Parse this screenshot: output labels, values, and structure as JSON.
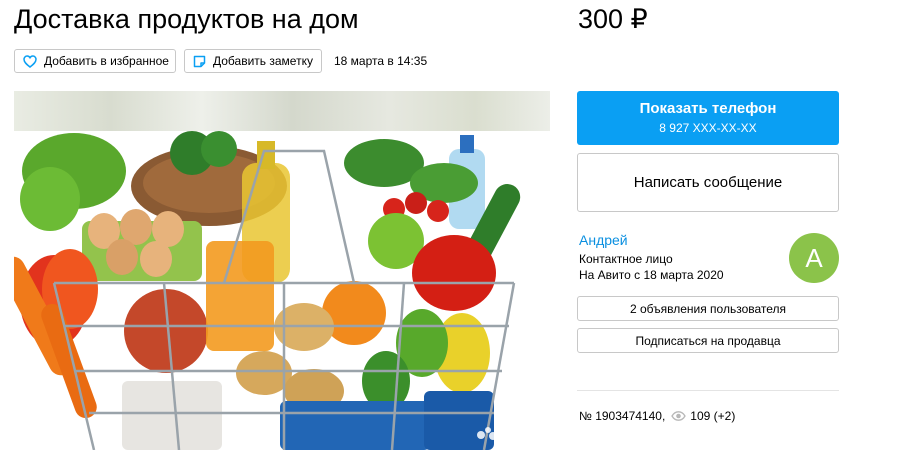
{
  "listing": {
    "title": "Доставка продуктов на дом",
    "price": "300 ₽",
    "date": "18 марта в 14:35"
  },
  "actions": {
    "favorite_label": "Добавить в избранное",
    "note_label": "Добавить заметку"
  },
  "photo": {
    "watermark": "Avito"
  },
  "contact": {
    "phone_title": "Показать телефон",
    "phone_number": "8 927 XXX-XX-XX",
    "message_label": "Написать сообщение"
  },
  "seller": {
    "name": "Андрей",
    "type": "Контактное лицо",
    "since": "На Авито с 18 марта 2020",
    "avatar_letter": "А",
    "ads_label": "2 объявления пользователя",
    "subscribe_label": "Подписаться на продавца"
  },
  "stats": {
    "id_text": "№ 1903474140,",
    "views_text": "109 (+2)"
  },
  "colors": {
    "accent": "#0a9ff3",
    "link": "#0a8fe0",
    "avatar": "#8bc34a",
    "border": "#c8c8c8"
  },
  "icons": {
    "favorite": "heart-outline-icon",
    "note": "note-icon",
    "views": "eye-icon",
    "watermark": "avito-logo-icon"
  }
}
